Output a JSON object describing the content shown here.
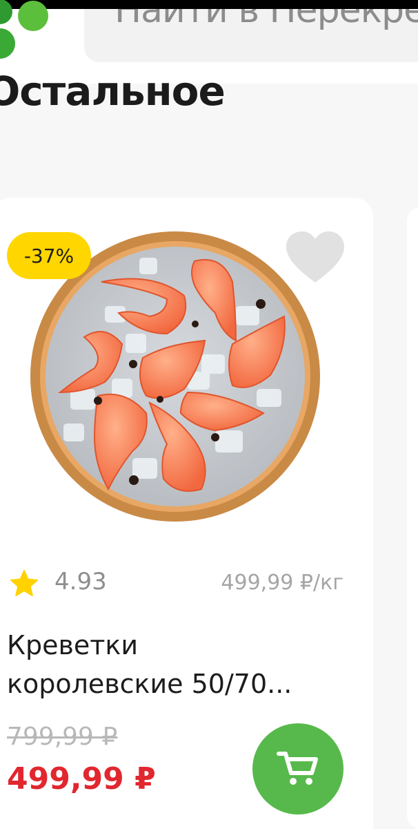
{
  "header": {
    "search_placeholder": "Найти в Перекрестке"
  },
  "section": {
    "title": "Остальное"
  },
  "product": {
    "discount": "-37%",
    "rating": "4.93",
    "unit_price": "499,99 ₽/кг",
    "name_line1": "Креветки",
    "name_line2": "королевские 50/70...",
    "old_price": "799,99 ₽",
    "new_price": "499,99 ₽",
    "image_icon": "shrimp-plate-image"
  },
  "icons": {
    "logo": "perekrestok-clover-logo",
    "favorite": "heart-icon",
    "rating": "star-icon",
    "cart": "cart-icon"
  },
  "colors": {
    "brand_green": "#57b94b",
    "badge_yellow": "#ffd600",
    "price_red": "#e1272f",
    "star_yellow": "#ffd200"
  }
}
